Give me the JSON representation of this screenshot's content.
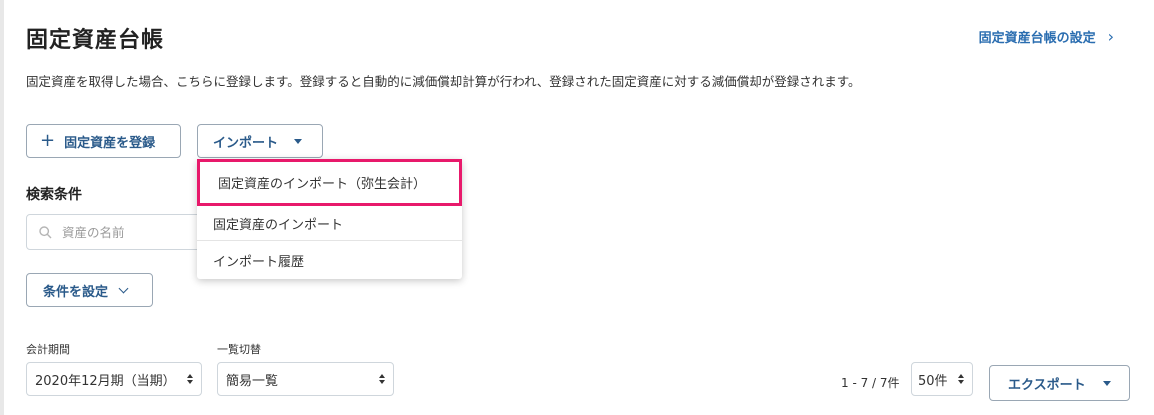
{
  "header": {
    "title": "固定資産台帳",
    "settings_link": "固定資産台帳の設定"
  },
  "description": "固定資産を取得した場合、こちらに登録します。登録すると自動的に減価償却計算が行われ、登録された固定資産に対する減価償却が登録されます。",
  "actions": {
    "register_label": "固定資産を登録",
    "import_label": "インポート"
  },
  "import_menu": {
    "items": [
      {
        "label": "固定資産のインポート（弥生会計）",
        "highlighted": true
      },
      {
        "label": "固定資産のインポート",
        "highlighted": false
      },
      {
        "label": "インポート履歴",
        "highlighted": false
      }
    ]
  },
  "search": {
    "section_label": "検索条件",
    "placeholder": "資産の名前",
    "condition_button": "条件を設定"
  },
  "filters": {
    "period_label": "会計期間",
    "period_value": "2020年12月期（当期）",
    "view_label": "一覧切替",
    "view_value": "簡易一覧"
  },
  "pagination": {
    "range": "1 - 7 / 7件",
    "per_page": "50件"
  },
  "export_label": "エクスポート",
  "colors": {
    "accent": "#2a6db0",
    "highlight_border": "#e8196b"
  }
}
